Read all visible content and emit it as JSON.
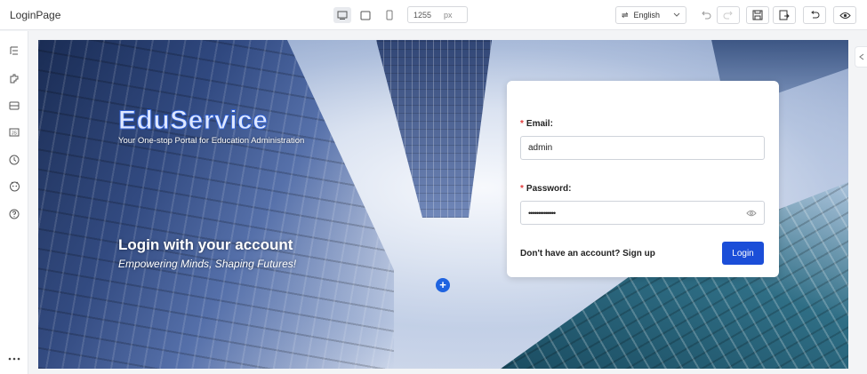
{
  "app": {
    "title": "LoginPage"
  },
  "toolbar": {
    "width_value": "1255",
    "width_unit": "px",
    "language": "English",
    "icons": [
      "desktop-icon",
      "tablet-icon",
      "mobile-icon",
      "undo-icon",
      "redo-icon",
      "save-icon",
      "export-icon",
      "return-icon",
      "preview-eye-icon"
    ]
  },
  "sidebar": {
    "icons": [
      "outline-icon",
      "components-icon",
      "datasource-icon",
      "code-icon",
      "history-icon",
      "assistant-icon",
      "help-icon",
      "more-icon"
    ]
  },
  "hero": {
    "brand": "EduService",
    "brand_tagline": "Your One-stop Portal for Education Administration",
    "title": "Login with your account",
    "subtitle": "Empowering Minds, Shaping Futures!"
  },
  "login_form": {
    "email_label": "Email:",
    "email_value": "admin",
    "password_label": "Password:",
    "password_value": "••••••••••••••",
    "required_mark": "*",
    "signup_text": "Don't have an account? Sign up",
    "login_button": "Login"
  },
  "add_button": "+",
  "colors": {
    "primary": "#1b4ed8",
    "required": "#e23b3b",
    "brand_stroke": "#2f5fd0"
  }
}
